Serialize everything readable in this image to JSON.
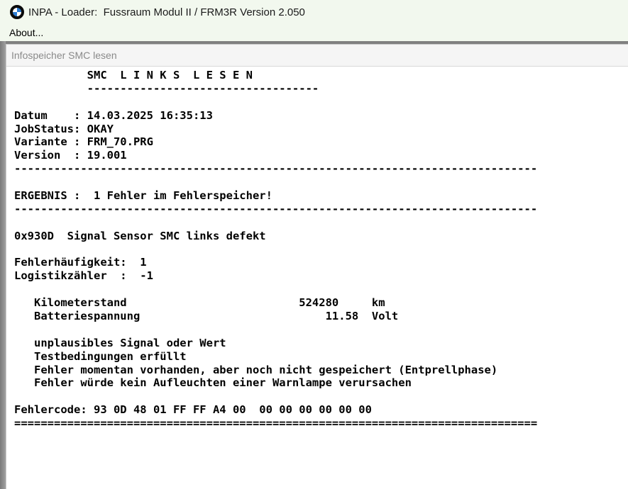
{
  "window": {
    "title": "INPA - Loader:  Fussraum Modul II / FRM3R Version 2.050",
    "icon": "bmw-logo-icon"
  },
  "menu": {
    "items": [
      "About..."
    ]
  },
  "child_window": {
    "title": "Infospeicher SMC lesen"
  },
  "output": {
    "lines": [
      "           SMC  L I N K S  L E S E N",
      "           -----------------------------------",
      "",
      "Datum    : 14.03.2025 16:35:13",
      "JobStatus: OKAY",
      "Variante : FRM_70.PRG",
      "Version  : 19.001",
      "-------------------------------------------------------------------------------",
      "",
      "ERGEBNIS :  1 Fehler im Fehlerspeicher!",
      "-------------------------------------------------------------------------------",
      "",
      "0x930D  Signal Sensor SMC links defekt",
      "",
      "Fehlerhäufigkeit:  1",
      "Logistikzähler  :  -1",
      "",
      "   Kilometerstand                          524280     km",
      "   Batteriespannung                            11.58  Volt",
      "",
      "   unplausibles Signal oder Wert",
      "   Testbedingungen erfüllt",
      "   Fehler momentan vorhanden, aber noch nicht gespeichert (Entprellphase)",
      "   Fehler würde kein Aufleuchten einer Warnlampe verursachen",
      "",
      "Fehlercode: 93 0D 48 01 FF FF A4 00  00 00 00 00 00 00",
      "==============================================================================="
    ]
  }
}
